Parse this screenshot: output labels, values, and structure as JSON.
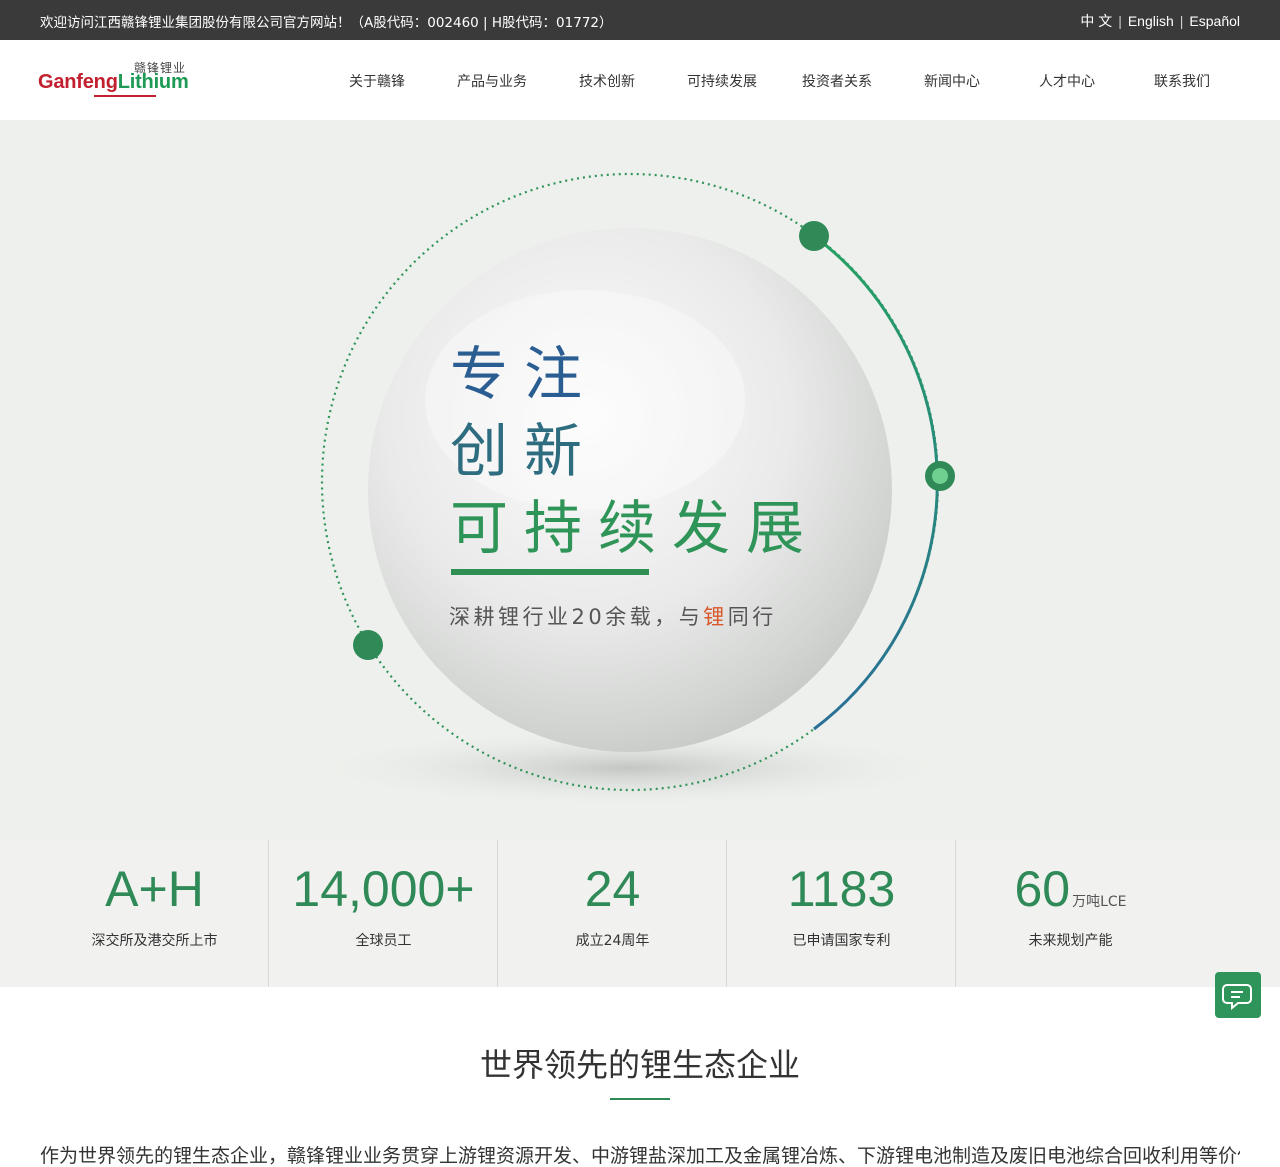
{
  "topbar": {
    "welcome": "欢迎访问江西赣锋锂业集团股份有限公司官方网站！（A股代码：002460 | H股代码：01772）",
    "languages": [
      {
        "label": "中 文"
      },
      {
        "label": "English"
      },
      {
        "label": "Español"
      }
    ],
    "separator": "|"
  },
  "logo": {
    "cn": "赣锋锂业",
    "en_part1": "Ganfeng",
    "en_part2": "Lithium",
    "brand_red": "#c3202f",
    "brand_green": "#1d9a55"
  },
  "nav": [
    {
      "label": "关于赣锋"
    },
    {
      "label": "产品与业务"
    },
    {
      "label": "技术创新"
    },
    {
      "label": "可持续发展"
    },
    {
      "label": "投资者关系"
    },
    {
      "label": "新闻中心"
    },
    {
      "label": "人才中心"
    },
    {
      "label": "联系我们"
    }
  ],
  "hero": {
    "line1": "专注",
    "line2": "创新",
    "line3": "可持续发展",
    "sub_before": "深耕锂行业20余载，与",
    "sub_highlight": "锂",
    "sub_after": "同行"
  },
  "stats": [
    {
      "value": "A+H",
      "unit": "",
      "label": "深交所及港交所上市"
    },
    {
      "value": "14,000+",
      "unit": "",
      "label": "全球员工"
    },
    {
      "value": "24",
      "unit": "",
      "label": "成立24周年"
    },
    {
      "value": "1183",
      "unit": "",
      "label": "已申请国家专利"
    },
    {
      "value": "60",
      "unit": "万吨LCE",
      "label": "未来规划产能"
    }
  ],
  "intro": {
    "title": "世界领先的锂生态企业",
    "text": "作为世界领先的锂生态企业，赣锋锂业业务贯穿上游锂资源开发、中游锂盐深加工及金属锂冶炼、下游锂电池制造及废旧电池综合回收利用等价值链的"
  },
  "icons": {
    "chat": "chat-bubble-icon"
  }
}
